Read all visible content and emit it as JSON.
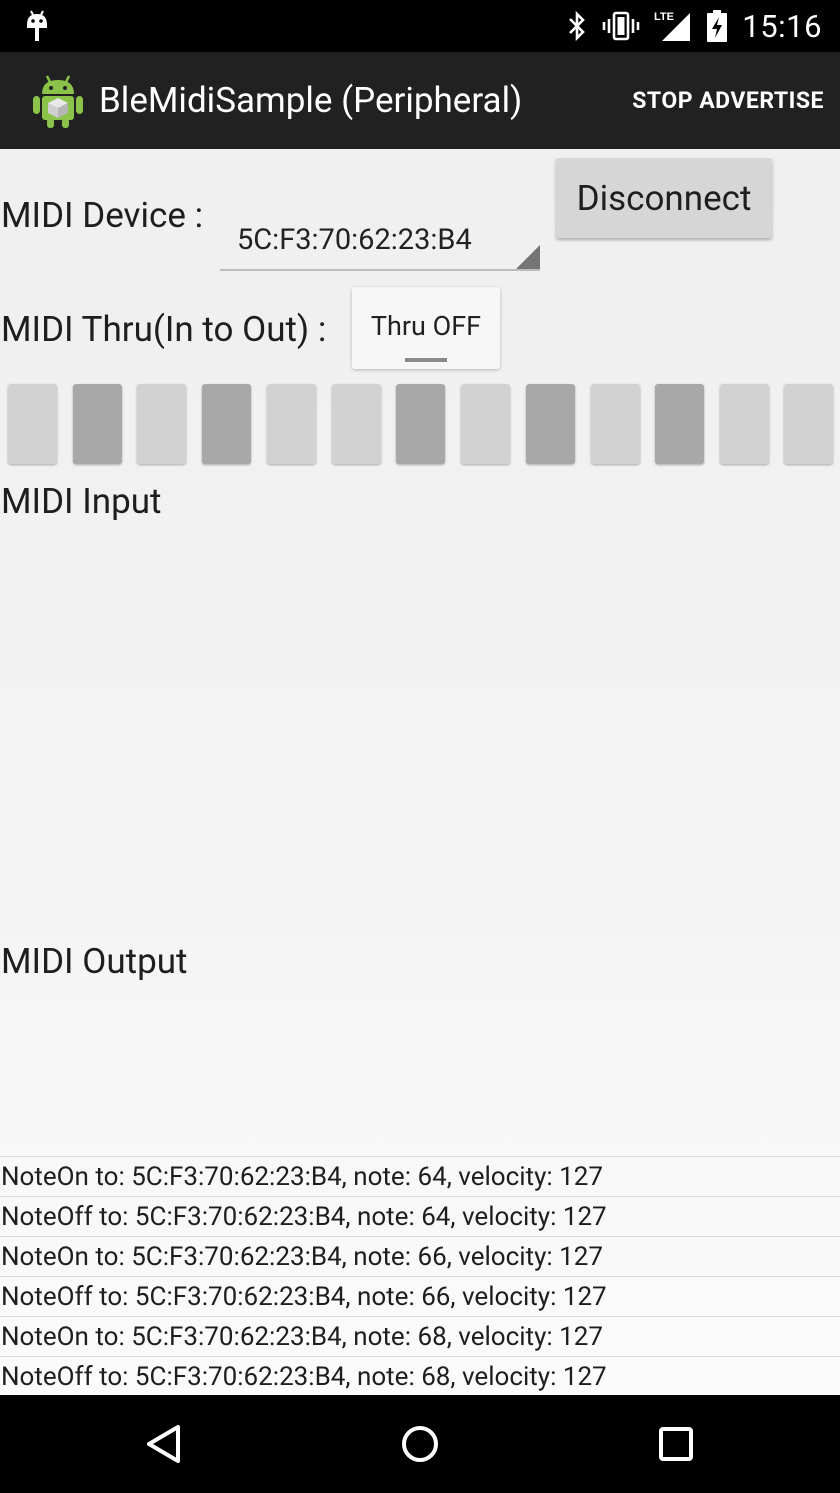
{
  "status_bar": {
    "time": "15:16",
    "icons": [
      "android-debug-icon",
      "bluetooth-icon",
      "vibrate-icon",
      "lte-signal-icon",
      "battery-charging-icon"
    ],
    "network_label": "LTE"
  },
  "action_bar": {
    "title": "BleMidiSample (Peripheral)",
    "action": "STOP ADVERTISE"
  },
  "device": {
    "label": "MIDI Device :",
    "selected": "5C:F3:70:62:23:B4",
    "disconnect_label": "Disconnect"
  },
  "thru": {
    "label": "MIDI Thru(In to Out) :",
    "toggle_label": "Thru OFF"
  },
  "keyboard": {
    "keys": [
      "white",
      "black",
      "white",
      "black",
      "white",
      "white",
      "black",
      "white",
      "black",
      "white",
      "black",
      "white",
      "white"
    ]
  },
  "sections": {
    "input_label": "MIDI Input",
    "output_label": "MIDI Output"
  },
  "output_log": [
    "NoteOn to: 5C:F3:70:62:23:B4, note: 64, velocity: 127",
    "NoteOff to: 5C:F3:70:62:23:B4, note: 64, velocity: 127",
    "NoteOn to: 5C:F3:70:62:23:B4, note: 66, velocity: 127",
    "NoteOff to: 5C:F3:70:62:23:B4, note: 66, velocity: 127",
    "NoteOn to: 5C:F3:70:62:23:B4, note: 68, velocity: 127",
    "NoteOff to: 5C:F3:70:62:23:B4, note: 68, velocity: 127"
  ],
  "nav_bar": [
    "back-icon",
    "home-icon",
    "recents-icon"
  ]
}
